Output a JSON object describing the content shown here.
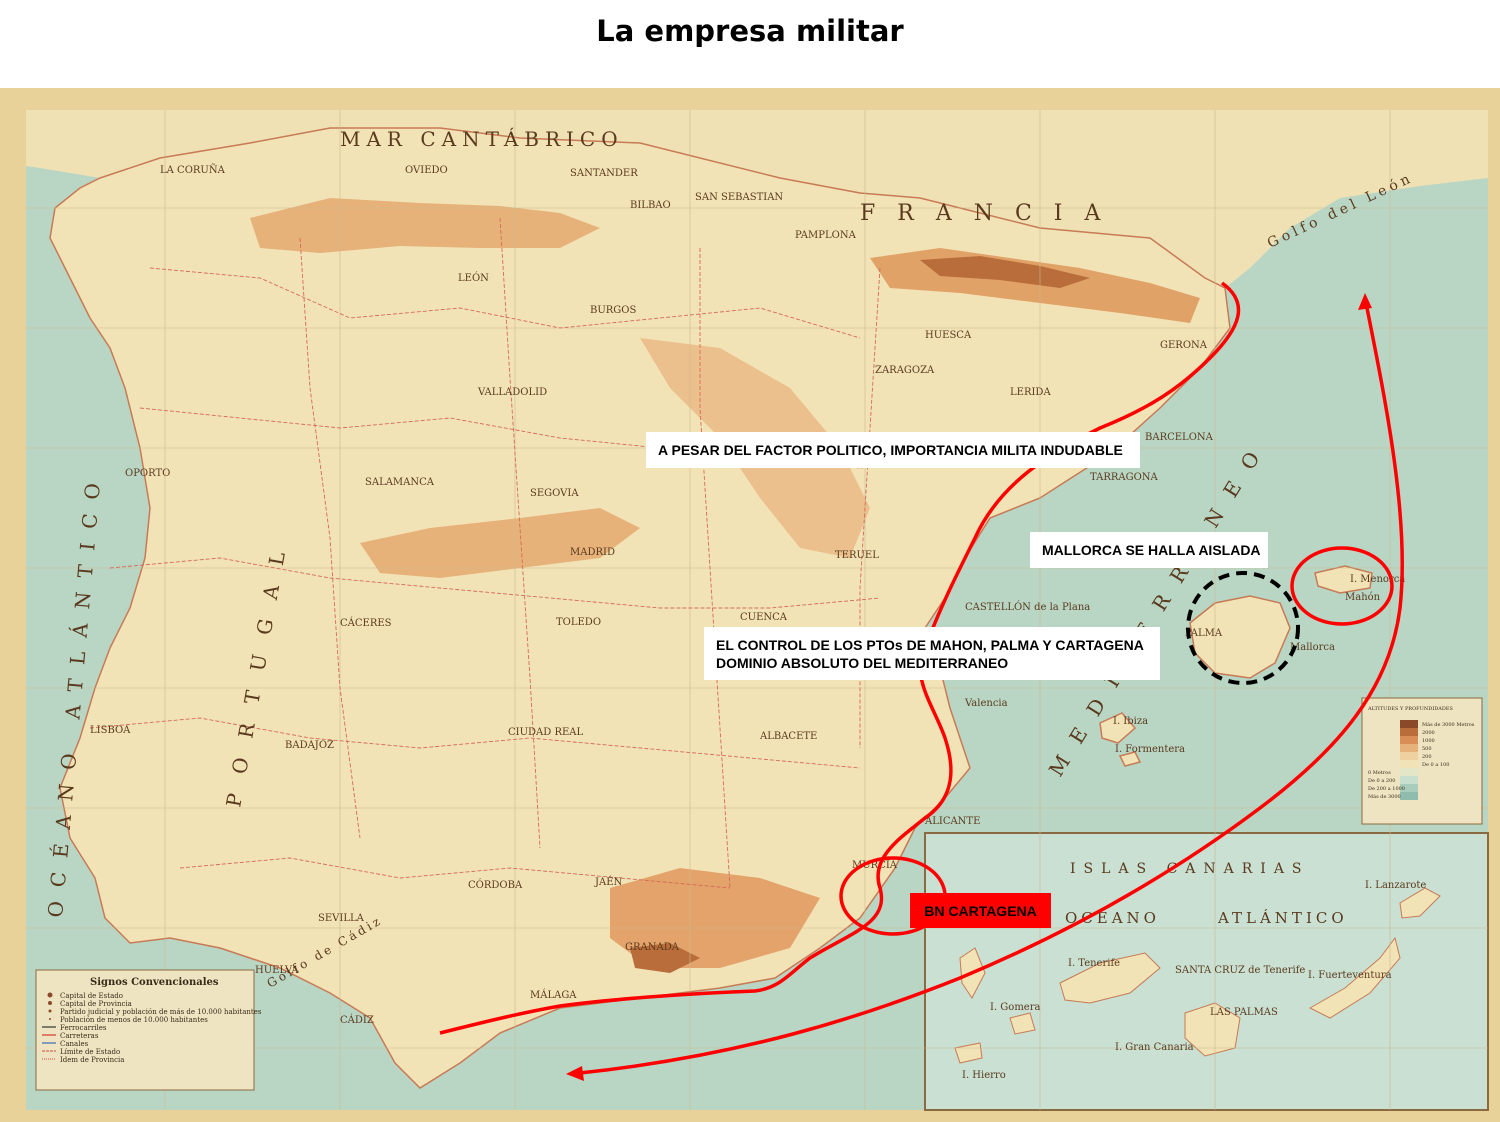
{
  "title": "La empresa militar",
  "annotations": {
    "politico": "A PESAR DEL FACTOR POLITICO, IMPORTANCIA MILITA INDUDABLE",
    "mallorca": "MALLORCA SE HALLA AISLADA",
    "control_line1": "EL CONTROL DE LOS PTOs DE MAHON, PALMA Y CARTAGENA",
    "control_line2": "DOMINIO ABSOLUTO DEL MEDITERRANEO",
    "cartagena": "BN CARTAGENA"
  },
  "map": {
    "seas": {
      "cantabrico": "MAR CANTÁBRICO",
      "atlantico": "OCÉANO ATLÁNTICO",
      "mediterraneo": "MEDITERRÁNEO",
      "francia": "FRANCIA",
      "portugal": "PORTUGAL",
      "golfo_leon": "Golfo del León",
      "golfo_cadiz": "Golfo de Cádiz"
    },
    "canarias": {
      "title": "ISLAS CANARIAS",
      "oceano": "OCÉANO",
      "atlantico": "ATLÁNTICO",
      "islands": [
        "I. Tenerife",
        "I. Gomera",
        "I. Hierro",
        "I. Gran Canaria",
        "I. Fuerteventura",
        "I. Lanzarote",
        "LAS PALMAS",
        "SANTA CRUZ de Tenerife"
      ]
    },
    "cities": [
      "LA CORUÑA",
      "OVIEDO",
      "SANTANDER",
      "BILBAO",
      "SAN SEBASTIAN",
      "LEÓN",
      "BURGOS",
      "PAMPLONA",
      "HUESCA",
      "LERIDA",
      "GERONA",
      "BARCELONA",
      "TARRAGONA",
      "ZARAGOZA",
      "VALLADOLID",
      "SALAMANCA",
      "SEGOVIA",
      "MADRID",
      "TOLEDO",
      "CUENCA",
      "TERUEL",
      "CASTELLÓN de la Plana",
      "Valencia",
      "ALICANTE",
      "MURCIA",
      "ALBACETE",
      "CIUDAD REAL",
      "BADAJOZ",
      "CÁCERES",
      "SEVILLA",
      "CÓRDOBA",
      "JAÉN",
      "GRANADA",
      "MÁLAGA",
      "CÁDIZ",
      "HUELVA",
      "LISBOA",
      "OPORTO",
      "PALMA",
      "I. Menorca",
      "Mallorca",
      "I. Ibiza",
      "I. Formentera",
      "Mahón"
    ],
    "legend": {
      "title": "Signos Convencionales",
      "items": [
        "Capital de Estado",
        "Capital de Provincia",
        "Partido judicial y población de más de 10.000 habitantes",
        "Población de menos de 10.000 habitantes",
        "Ferrocarriles",
        "Carreteras",
        "Canales",
        "Límite de Estado",
        "Idem de Provincia"
      ]
    },
    "altitudes": {
      "title": "ALTITUDES Y PROFUNDIDADES",
      "items": [
        "Más de 3000 Metros",
        "2000",
        "1000",
        "500",
        "200",
        "De 0 a 100",
        "0 Metros",
        "De 0 a 200",
        "De 200 a 1000",
        "Más de 3000"
      ]
    }
  },
  "colors": {
    "sea": "#b9d6c4",
    "land": "#f2e3b6",
    "mountain": "#e0a266",
    "route": "#ff0000",
    "frame": "#e8d29a"
  }
}
